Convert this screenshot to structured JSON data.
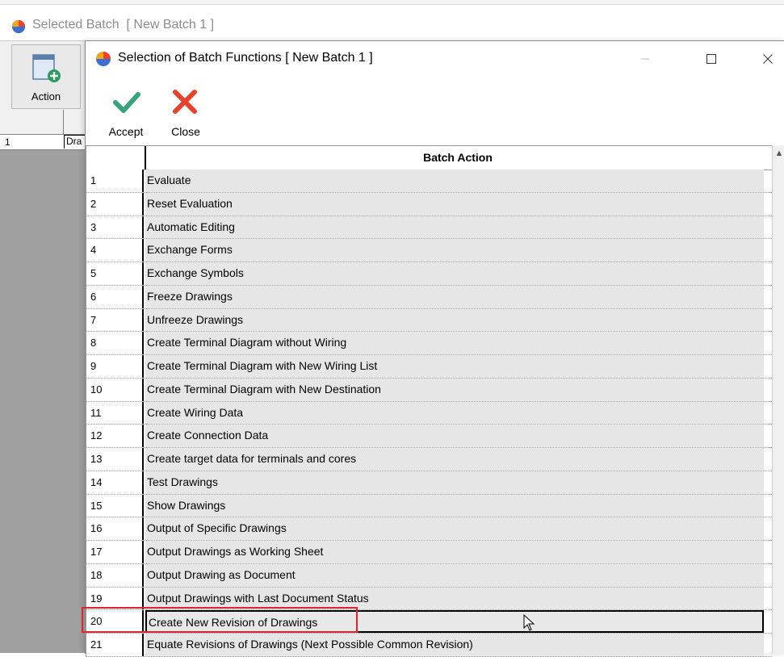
{
  "background_window": {
    "title": "Selected Batch  [ New Batch 1 ]",
    "action_label": "Action",
    "grid_row": {
      "num": "1",
      "cell": "Dra"
    }
  },
  "dialog": {
    "title": "Selection of Batch Functions [ New Batch 1 ]",
    "toolbar": {
      "accept_label": "Accept",
      "close_label": "Close"
    },
    "grid": {
      "column_header": "Batch Action",
      "rows": [
        {
          "num": "1",
          "label": "Evaluate"
        },
        {
          "num": "2",
          "label": "Reset Evaluation"
        },
        {
          "num": "3",
          "label": "Automatic Editing"
        },
        {
          "num": "4",
          "label": "Exchange Forms"
        },
        {
          "num": "5",
          "label": "Exchange Symbols"
        },
        {
          "num": "6",
          "label": "Freeze Drawings"
        },
        {
          "num": "7",
          "label": "Unfreeze Drawings"
        },
        {
          "num": "8",
          "label": "Create Terminal Diagram without Wiring"
        },
        {
          "num": "9",
          "label": "Create Terminal Diagram with New Wiring List"
        },
        {
          "num": "10",
          "label": "Create Terminal Diagram with New Destination"
        },
        {
          "num": "11",
          "label": "Create Wiring Data"
        },
        {
          "num": "12",
          "label": "Create Connection Data"
        },
        {
          "num": "13",
          "label": "Create target data for terminals and cores"
        },
        {
          "num": "14",
          "label": "Test Drawings"
        },
        {
          "num": "15",
          "label": "Show Drawings"
        },
        {
          "num": "16",
          "label": "Output of Specific Drawings"
        },
        {
          "num": "17",
          "label": "Output Drawings as Working Sheet"
        },
        {
          "num": "18",
          "label": "Output Drawing as Document"
        },
        {
          "num": "19",
          "label": "Output Drawings with Last Document Status"
        },
        {
          "num": "20",
          "label": "Create New Revision of Drawings"
        },
        {
          "num": "21",
          "label": "Equate Revisions of Drawings (Next Possible Common Revision)"
        }
      ],
      "selected_row": "20"
    }
  },
  "colors": {
    "accept_green": "#3aa17e",
    "close_red": "#e2452f",
    "highlight_red": "#e0242e"
  }
}
